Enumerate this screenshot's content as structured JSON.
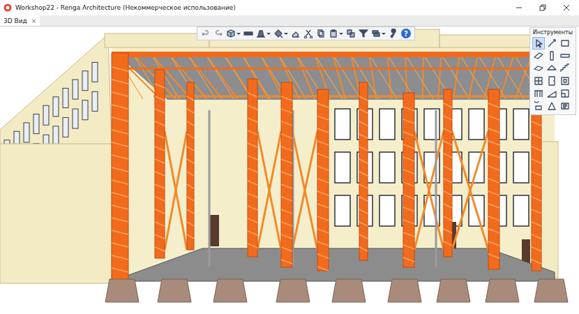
{
  "window": {
    "title": "Workshop22 - Renga Architecture (Некоммерческое использование)"
  },
  "tabs": [
    {
      "label": "3D Вид",
      "close": "×",
      "selected": true
    }
  ],
  "toolbar": [
    {
      "kind": "undo",
      "menu": false
    },
    {
      "kind": "redo",
      "menu": false
    },
    {
      "kind": "view-cube",
      "menu": true
    },
    {
      "kind": "section",
      "menu": false
    },
    {
      "kind": "visibility",
      "menu": true
    },
    {
      "kind": "paint",
      "menu": true
    },
    {
      "kind": "eraser",
      "menu": false
    },
    {
      "kind": "cut",
      "menu": false
    },
    {
      "kind": "copy",
      "menu": false
    },
    {
      "kind": "paste",
      "menu": true
    },
    {
      "kind": "paste-special",
      "menu": false
    },
    {
      "kind": "filter",
      "menu": false
    },
    {
      "kind": "layers",
      "menu": true
    },
    {
      "kind": "wrench",
      "menu": false
    },
    {
      "kind": "help",
      "glyph": "?",
      "menu": false
    }
  ],
  "tools_panel": {
    "title": "Инструменты",
    "tools": [
      {
        "kind": "select",
        "selected": true
      },
      {
        "kind": "line",
        "selected": false
      },
      {
        "kind": "rectangle",
        "selected": false
      },
      {
        "kind": "wall",
        "selected": false
      },
      {
        "kind": "column",
        "selected": false
      },
      {
        "kind": "beam",
        "selected": false
      },
      {
        "kind": "slab",
        "selected": false
      },
      {
        "kind": "roof",
        "selected": false
      },
      {
        "kind": "stair",
        "selected": false
      },
      {
        "kind": "window",
        "selected": false
      },
      {
        "kind": "door",
        "selected": false
      },
      {
        "kind": "opening",
        "selected": false
      },
      {
        "kind": "railing",
        "selected": false
      },
      {
        "kind": "ramp",
        "selected": false
      },
      {
        "kind": "room",
        "selected": false
      },
      {
        "kind": "equipment",
        "selected": false
      },
      {
        "kind": "figure",
        "selected": false
      },
      {
        "kind": "dimension",
        "selected": false
      }
    ]
  }
}
